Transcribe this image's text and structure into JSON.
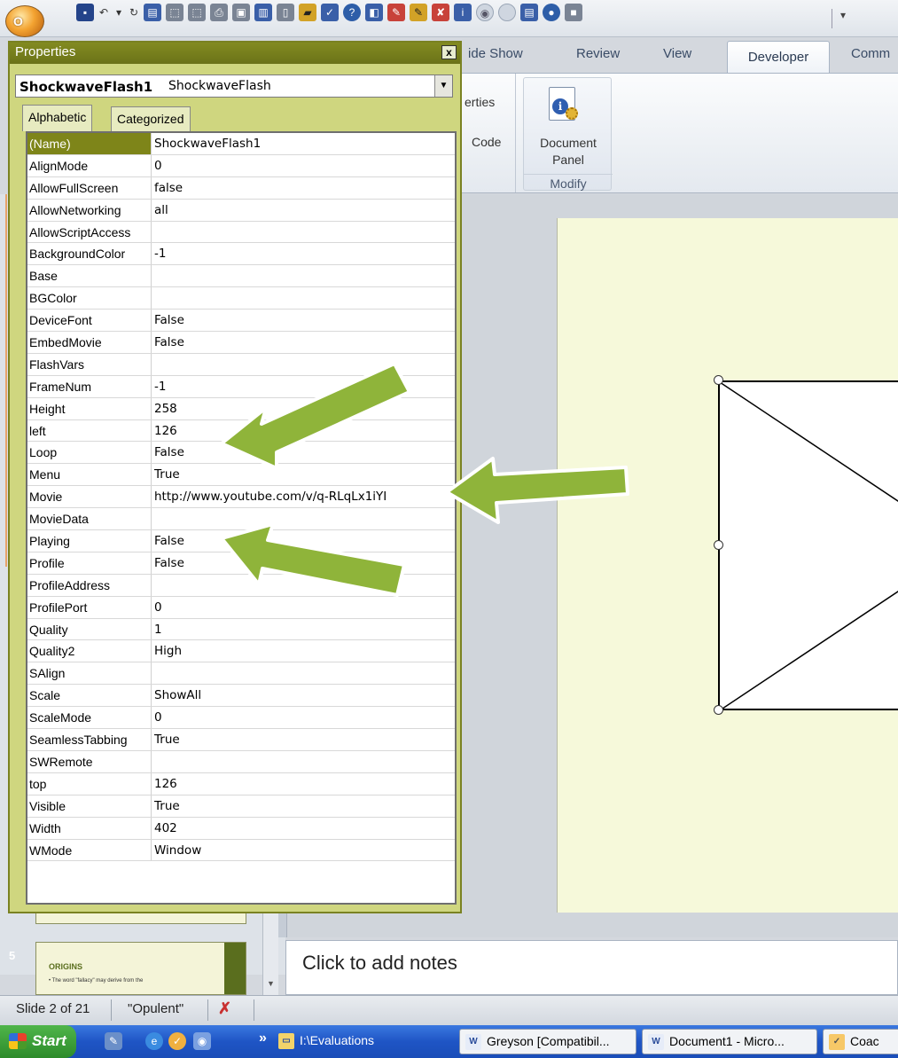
{
  "ribbon": {
    "tabs": [
      {
        "label": "ide Show"
      },
      {
        "label": "Review"
      },
      {
        "label": "View"
      },
      {
        "label": "Developer"
      },
      {
        "label": "Comm"
      }
    ],
    "controls_group": {
      "properties_label": "erties",
      "view_code_label": "Code"
    },
    "modify_group": {
      "document_panel_label_line1": "Document",
      "document_panel_label_line2": "Panel",
      "group_label": "Modify"
    }
  },
  "properties_window": {
    "title": "Properties",
    "close_label": "x",
    "object_name": "ShockwaveFlash1",
    "object_type": "ShockwaveFlash",
    "tabs": {
      "alphabetic": "Alphabetic",
      "categorized": "Categorized"
    },
    "rows": [
      {
        "key": "(Name)",
        "value": "ShockwaveFlash1"
      },
      {
        "key": "AlignMode",
        "value": "0"
      },
      {
        "key": "AllowFullScreen",
        "value": "false"
      },
      {
        "key": "AllowNetworking",
        "value": "all"
      },
      {
        "key": "AllowScriptAccess",
        "value": ""
      },
      {
        "key": "BackgroundColor",
        "value": "-1"
      },
      {
        "key": "Base",
        "value": ""
      },
      {
        "key": "BGColor",
        "value": ""
      },
      {
        "key": "DeviceFont",
        "value": "False"
      },
      {
        "key": "EmbedMovie",
        "value": "False"
      },
      {
        "key": "FlashVars",
        "value": ""
      },
      {
        "key": "FrameNum",
        "value": "-1"
      },
      {
        "key": "Height",
        "value": "258"
      },
      {
        "key": "left",
        "value": "126"
      },
      {
        "key": "Loop",
        "value": "False"
      },
      {
        "key": "Menu",
        "value": "True"
      },
      {
        "key": "Movie",
        "value": "http://www.youtube.com/v/q-RLqLx1iYI"
      },
      {
        "key": "MovieData",
        "value": ""
      },
      {
        "key": "Playing",
        "value": "False"
      },
      {
        "key": "Profile",
        "value": "False"
      },
      {
        "key": "ProfileAddress",
        "value": ""
      },
      {
        "key": "ProfilePort",
        "value": "0"
      },
      {
        "key": "Quality",
        "value": "1"
      },
      {
        "key": "Quality2",
        "value": "High"
      },
      {
        "key": "SAlign",
        "value": ""
      },
      {
        "key": "Scale",
        "value": "ShowAll"
      },
      {
        "key": "ScaleMode",
        "value": "0"
      },
      {
        "key": "SeamlessTabbing",
        "value": "True"
      },
      {
        "key": "SWRemote",
        "value": ""
      },
      {
        "key": "top",
        "value": "126"
      },
      {
        "key": "Visible",
        "value": "True"
      },
      {
        "key": "Width",
        "value": "402"
      },
      {
        "key": "WMode",
        "value": "Window"
      }
    ]
  },
  "slides_pane": {
    "slide_number": "5",
    "thumb_title": "ORIGINS",
    "thumb_text": "• The word \"fallacy\" may derive from the"
  },
  "notes": {
    "placeholder": "Click to add notes"
  },
  "status_bar": {
    "slide_info": "Slide 2 of 21",
    "theme": "\"Opulent\""
  },
  "taskbar": {
    "start_label": "Start",
    "overflow": "»",
    "tasks": [
      {
        "label": "I:\\Evaluations"
      },
      {
        "label": "Greyson [Compatibil..."
      },
      {
        "label": "Document1 - Micro..."
      },
      {
        "label": "Coac"
      }
    ]
  },
  "colors": {
    "accent_olive": "#7e8519",
    "window_bg": "#cfd67f",
    "slide_bg": "#f6f9da",
    "arrow_green": "#8fb43a"
  }
}
